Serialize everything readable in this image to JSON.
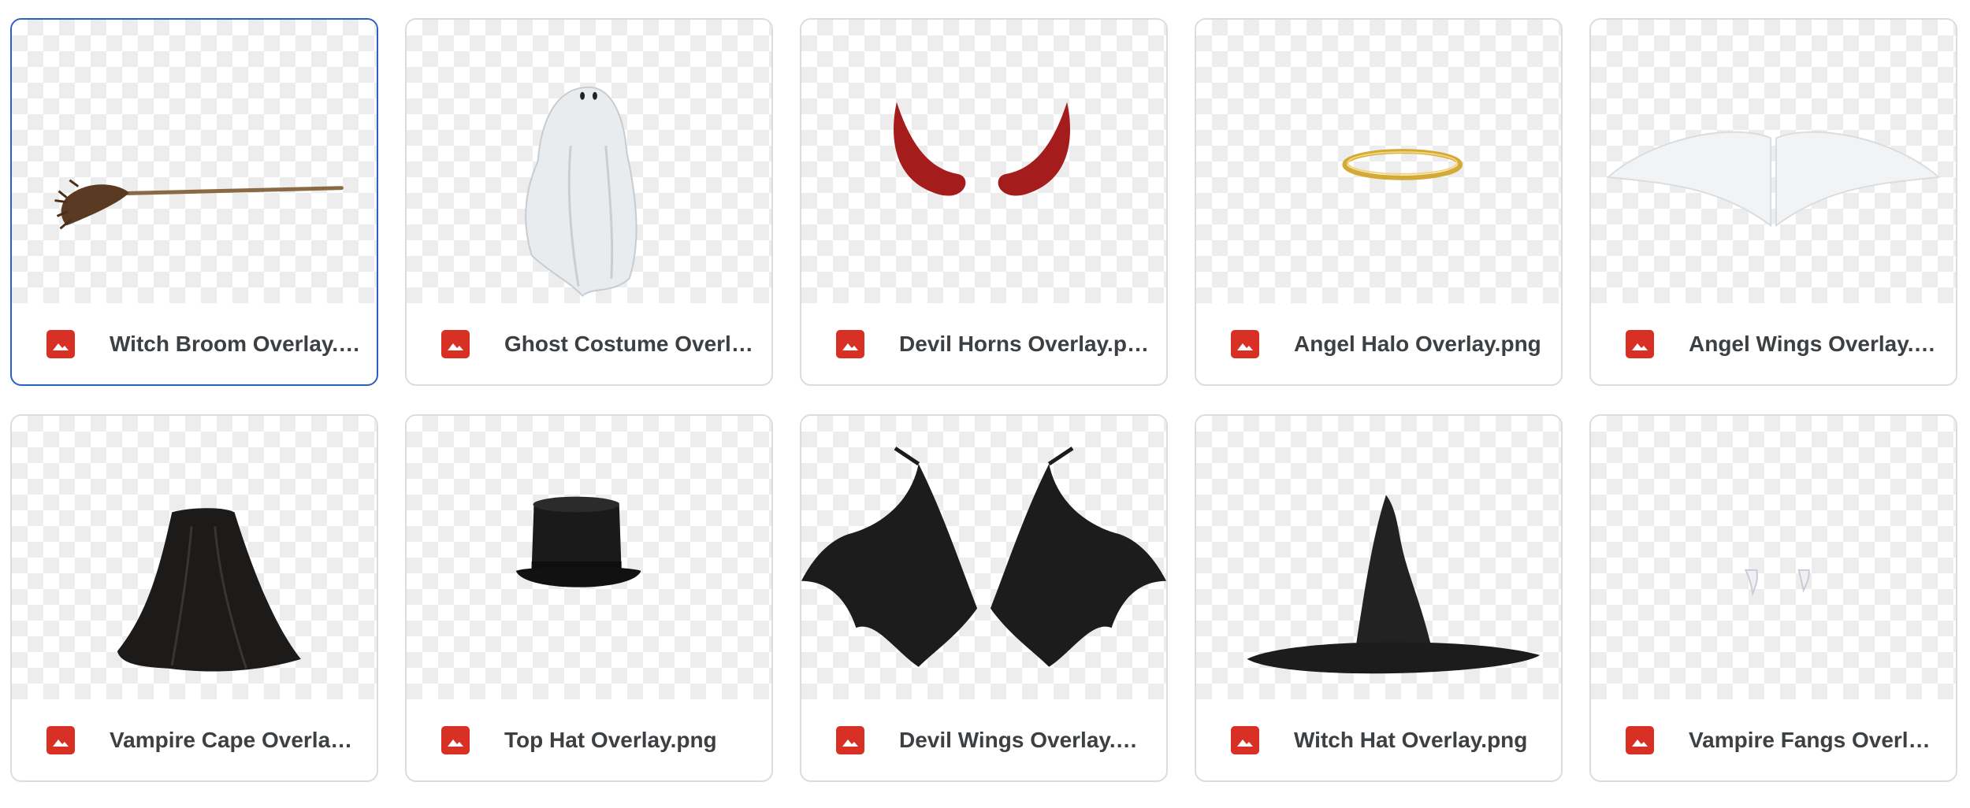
{
  "files": [
    {
      "name": "Witch Broom Overlay.png",
      "display": "Witch Broom Overlay.p...",
      "selected": true
    },
    {
      "name": "Ghost Costume Overlay.png",
      "display": "Ghost Costume Overla...",
      "selected": false
    },
    {
      "name": "Devil Horns Overlay.png",
      "display": "Devil Horns Overlay.png",
      "selected": false
    },
    {
      "name": "Angel Halo Overlay.png",
      "display": "Angel Halo Overlay.png",
      "selected": false
    },
    {
      "name": "Angel Wings Overlay.png",
      "display": "Angel Wings Overlay.p...",
      "selected": false
    },
    {
      "name": "Vampire Cape Overlay.png",
      "display": "Vampire Cape Overlay....",
      "selected": false
    },
    {
      "name": "Top Hat Overlay.png",
      "display": "Top Hat Overlay.png",
      "selected": false
    },
    {
      "name": "Devil Wings Overlay.png",
      "display": "Devil Wings Overlay.png",
      "selected": false
    },
    {
      "name": "Witch Hat Overlay.png",
      "display": "Witch Hat Overlay.png",
      "selected": false
    },
    {
      "name": "Vampire Fangs Overlay.png",
      "display": "Vampire Fangs Overlay...",
      "selected": false
    }
  ],
  "file_type_icon": "image-file-icon",
  "colors": {
    "image_icon": "#d93025",
    "selected_border": "#2b5fc8",
    "border": "#dadce0"
  }
}
